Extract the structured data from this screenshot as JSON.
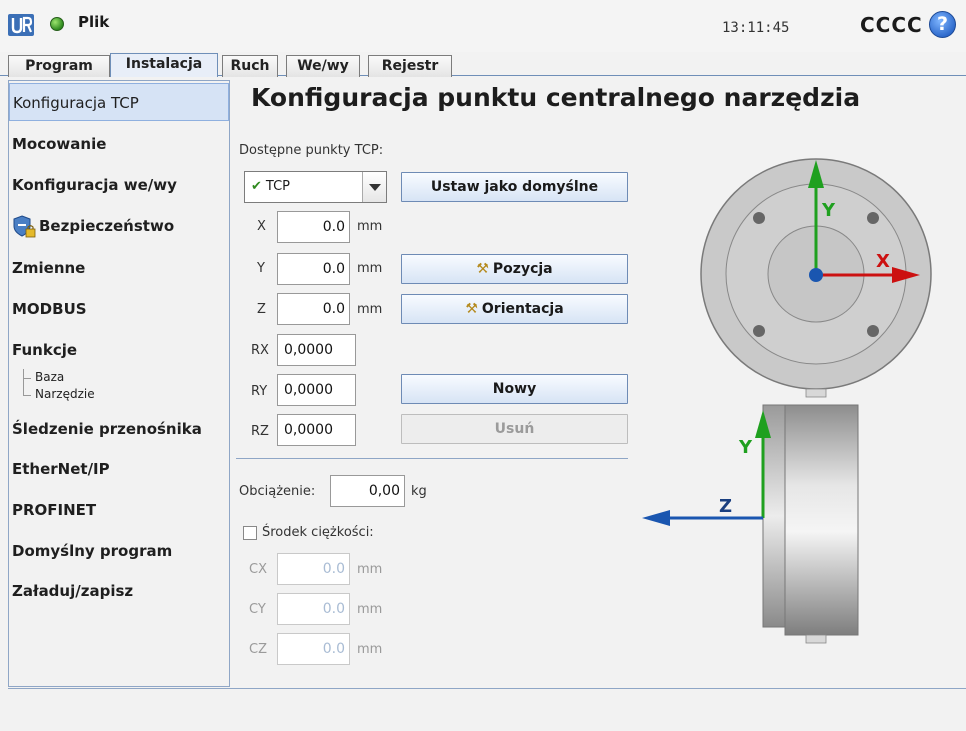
{
  "header": {
    "file_menu": "Plik",
    "clock": "13:11:45",
    "robot_name": "CCCC",
    "help_label": "?"
  },
  "tabs": [
    {
      "label": "Program"
    },
    {
      "label": "Instalacja"
    },
    {
      "label": "Ruch"
    },
    {
      "label": "We/wy"
    },
    {
      "label": "Rejestr"
    }
  ],
  "sidebar": {
    "items": [
      {
        "label": "Konfiguracja TCP"
      },
      {
        "label": "Mocowanie"
      },
      {
        "label": "Konfiguracja we/wy"
      },
      {
        "label": "Bezpieczeństwo"
      },
      {
        "label": "Zmienne"
      },
      {
        "label": "MODBUS"
      },
      {
        "label": "Funkcje"
      },
      {
        "label": "Śledzenie przenośnika"
      },
      {
        "label": "EtherNet/IP"
      },
      {
        "label": "PROFINET"
      },
      {
        "label": "Domyślny program"
      },
      {
        "label": "Załaduj/zapisz"
      }
    ],
    "sub_items": [
      {
        "label": "Baza"
      },
      {
        "label": "Narzędzie"
      }
    ]
  },
  "main": {
    "title": "Konfiguracja punktu centralnego narzędzia",
    "available_tcp_label": "Dostępne punkty TCP:",
    "tcp_selected": "TCP",
    "set_default_button": "Ustaw jako domyślne",
    "position_button": "Pozycja",
    "orientation_button": "Orientacja",
    "new_button": "Nowy",
    "delete_button": "Usuń",
    "fields": [
      {
        "axis": "X",
        "value": "0.0",
        "unit": "mm"
      },
      {
        "axis": "Y",
        "value": "0.0",
        "unit": "mm"
      },
      {
        "axis": "Z",
        "value": "0.0",
        "unit": "mm"
      },
      {
        "axis": "RX",
        "value": "0,0000"
      },
      {
        "axis": "RY",
        "value": "0,0000"
      },
      {
        "axis": "RZ",
        "value": "0,0000"
      }
    ],
    "payload_label": "Obciążenie:",
    "payload_value": "0,00",
    "payload_unit": "kg",
    "cog_checkbox_label": "Środek ciężkości:",
    "cog_checked": false,
    "cog_fields": [
      {
        "axis": "CX",
        "value": "0.0",
        "unit": "mm"
      },
      {
        "axis": "CY",
        "value": "0.0",
        "unit": "mm"
      },
      {
        "axis": "CZ",
        "value": "0.0",
        "unit": "mm"
      }
    ]
  },
  "illustration": {
    "front_view_axes": {
      "x": "X",
      "y": "Y"
    },
    "side_view_axes": {
      "y": "Y",
      "z": "Z"
    },
    "colors": {
      "x_axis": "#cc1111",
      "y_axis": "#1fa01f",
      "z_axis": "#1a56b0"
    }
  }
}
